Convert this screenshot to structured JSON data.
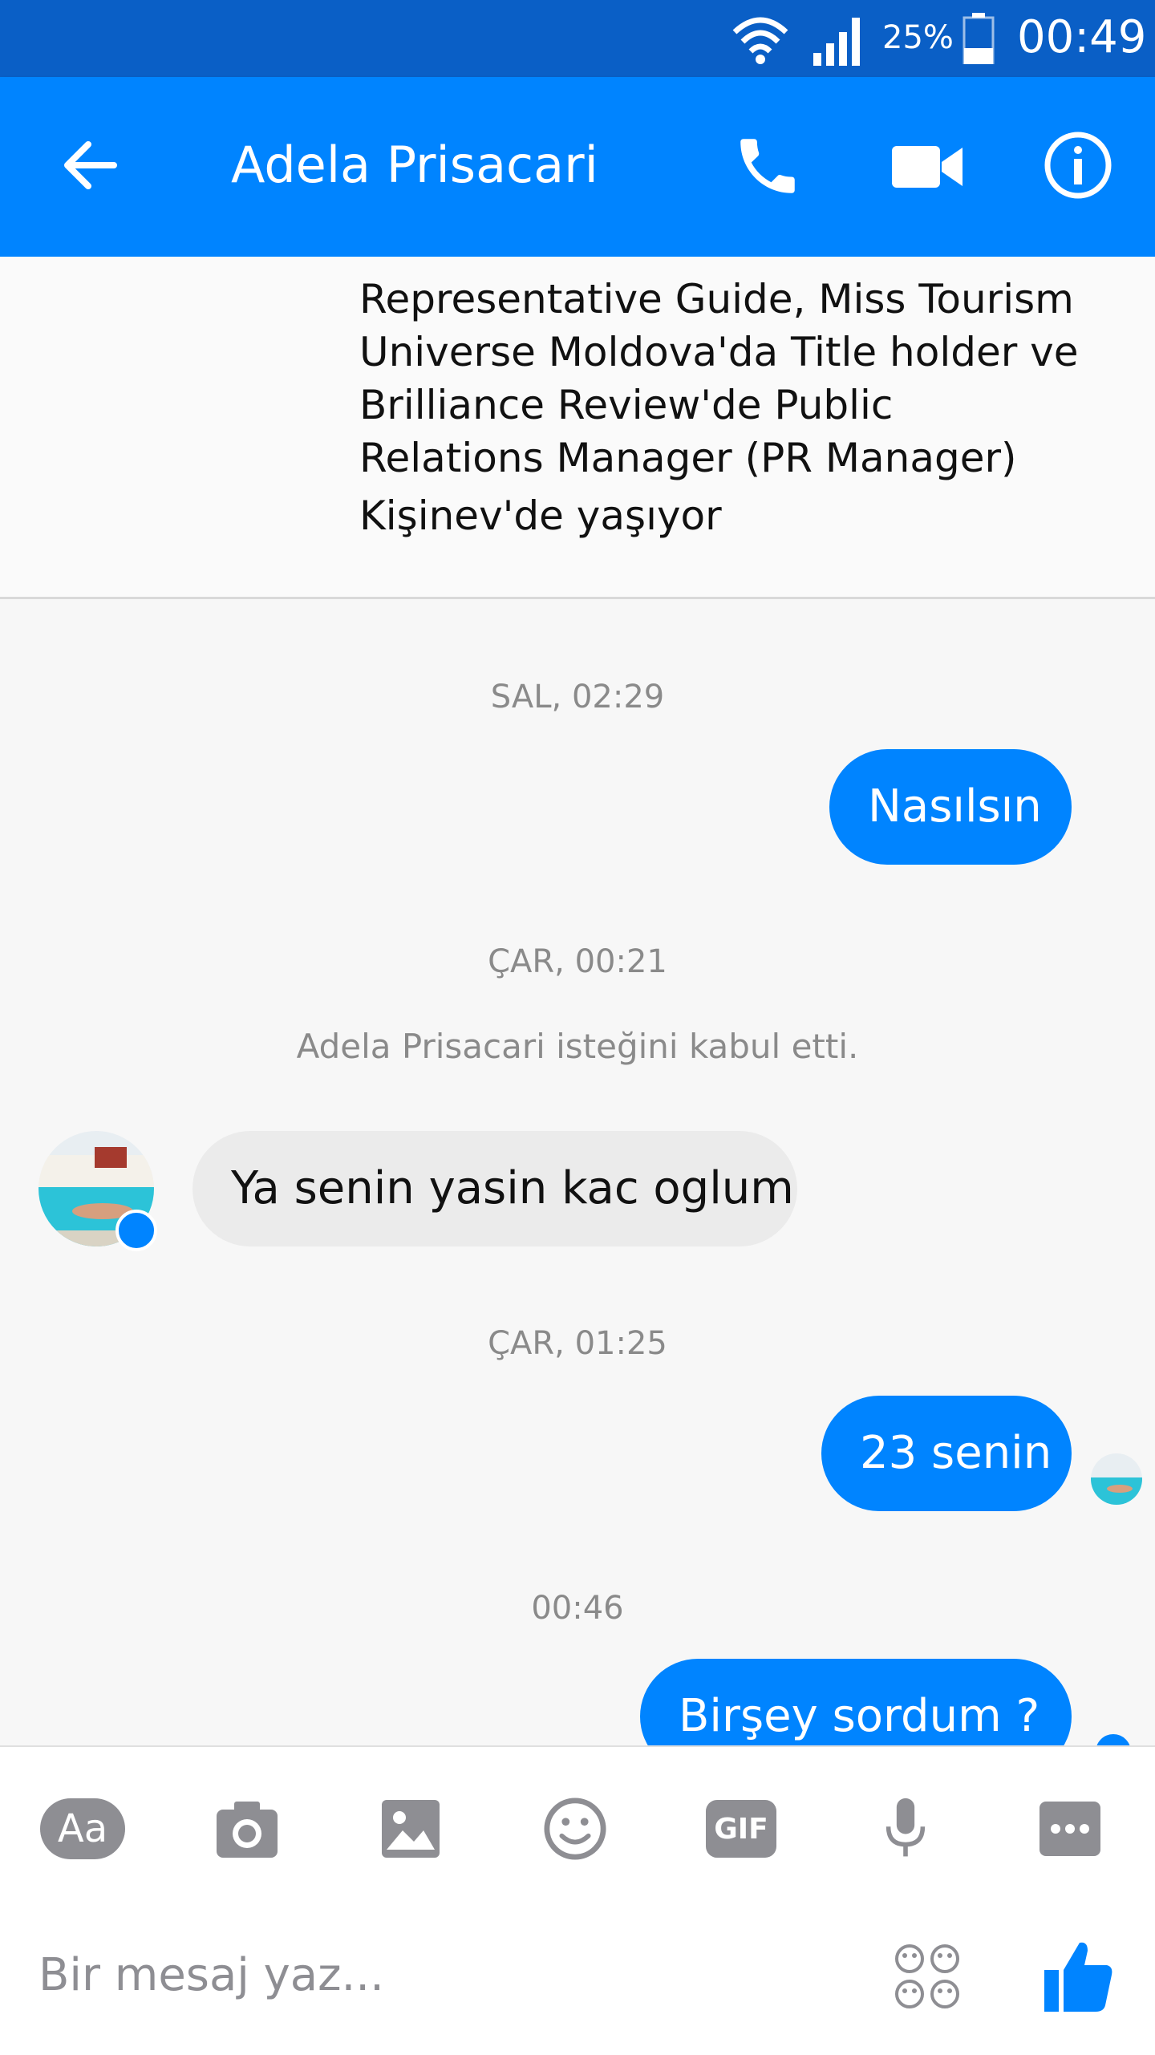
{
  "status_bar": {
    "battery_percent": "25%",
    "time": "00:49"
  },
  "app_bar": {
    "contact_name": "Adela Prisacari"
  },
  "profile": {
    "work_text": "Representative Guide, Miss Tourism Universe Moldova'da Title holder ve Brilliance Review'de Public Relations Manager (PR Manager)",
    "lives_text": "Kişinev'de yaşıyor"
  },
  "messages": {
    "ts1": "SAL, 02:29",
    "msg1": "Nasılsın",
    "ts2": "ÇAR, 00:21",
    "system1": "Adela Prisacari isteğini kabul etti.",
    "msg2": "Ya senin yasin kac oglum",
    "ts3": "ÇAR, 01:25",
    "msg3": "23 senin",
    "ts4": "00:46",
    "msg4": "Birşey sordum ?"
  },
  "composer": {
    "aa_label": "Aa",
    "gif_label": "GIF",
    "placeholder": "Bir mesaj yaz..."
  },
  "colors": {
    "brand": "#0084ff",
    "status_bar": "#0a5fc6",
    "incoming_bubble": "#ebebeb",
    "icon_gray": "#8e8e93"
  }
}
